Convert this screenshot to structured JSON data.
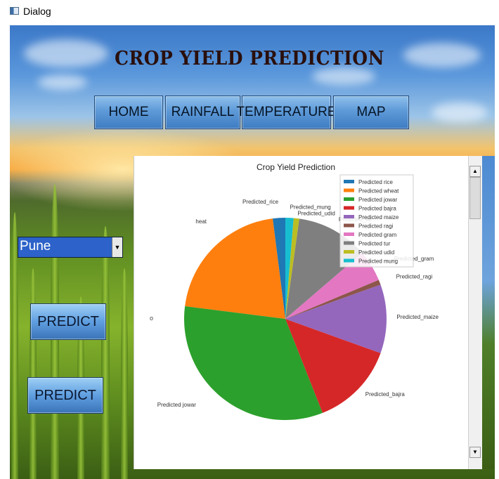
{
  "window": {
    "title": "Dialog"
  },
  "app": {
    "title": "CROP YIELD PREDICTION"
  },
  "nav": {
    "home": "HOME",
    "rainfall": "RAINFALL",
    "temperature": "TEMPERATURE",
    "map": "MAP"
  },
  "location_select": {
    "value": "Pune"
  },
  "buttons": {
    "predict_1": "PREDICT",
    "predict_2": "PREDICT"
  },
  "chart_data": {
    "type": "pie",
    "title": "Crop Yield Prediction",
    "stray_label": "o",
    "slices": [
      {
        "label": "Predicted_rice",
        "legend": "Predicted rice",
        "value": 2.0,
        "color": "#1f77b4",
        "label_text": "Predicted_rice"
      },
      {
        "label": "Predicted_wheat",
        "legend": "Predicted wheat",
        "value": 21.0,
        "color": "#ff7f0e",
        "label_text": "heat"
      },
      {
        "label": "Predicted_jowar",
        "legend": "Predicted jowar",
        "value": 33.0,
        "color": "#2ca02c",
        "label_text": "Predicted jowar"
      },
      {
        "label": "Predicted_bajra",
        "legend": "Predicted bajra",
        "value": 13.5,
        "color": "#d62728",
        "label_text": "Predicted_bajra"
      },
      {
        "label": "Predicted_maize",
        "legend": "Predicted maize",
        "value": 11.0,
        "color": "#9467bd",
        "label_text": "Predicted_maize"
      },
      {
        "label": "Predicted_ragi",
        "legend": "Predicted ragi",
        "value": 0.8,
        "color": "#8c564b",
        "label_text": "Predicted_ragi"
      },
      {
        "label": "Predicted_gram",
        "legend": "Predicted gram",
        "value": 5.0,
        "color": "#e377c2",
        "label_text": "Predicted_gram"
      },
      {
        "label": "Predicted_tur",
        "legend": "Predicted tur",
        "value": 11.5,
        "color": "#7f7f7f",
        "label_text": "Predicted_tur"
      },
      {
        "label": "Predicted_udid",
        "legend": "Predicted udid",
        "value": 0.9,
        "color": "#bcbd22",
        "label_text": "Predicted_udid"
      },
      {
        "label": "Predicted_mung",
        "legend": "Predicted mung",
        "value": 1.3,
        "color": "#17becf",
        "label_text": "Predicted_mung"
      }
    ],
    "legend_position": "top-right",
    "start_angle_deg": 90,
    "direction": "counterclockwise"
  }
}
